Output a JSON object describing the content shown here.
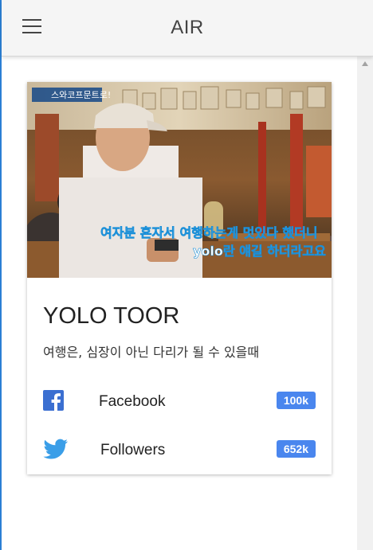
{
  "app": {
    "title": "AIR"
  },
  "card": {
    "image": {
      "caption_top": "스와코프문트로!",
      "subtitle_line1": "여자분 혼자서 여행하는게 멋있다 했더니",
      "subtitle_line2": "yolo란 얘길 하더라고요"
    },
    "title": "YOLO TOOR",
    "subtitle": "여행은, 심장이 아닌 다리가 될 수 있을때",
    "social": [
      {
        "label": "Facebook",
        "count": "100k",
        "icon": "facebook-icon"
      },
      {
        "label": "Followers",
        "count": "652k",
        "icon": "twitter-icon"
      }
    ]
  },
  "colors": {
    "badge": "#4a86ee",
    "facebook": "#3b6fd1",
    "twitter": "#3a9ee8"
  }
}
